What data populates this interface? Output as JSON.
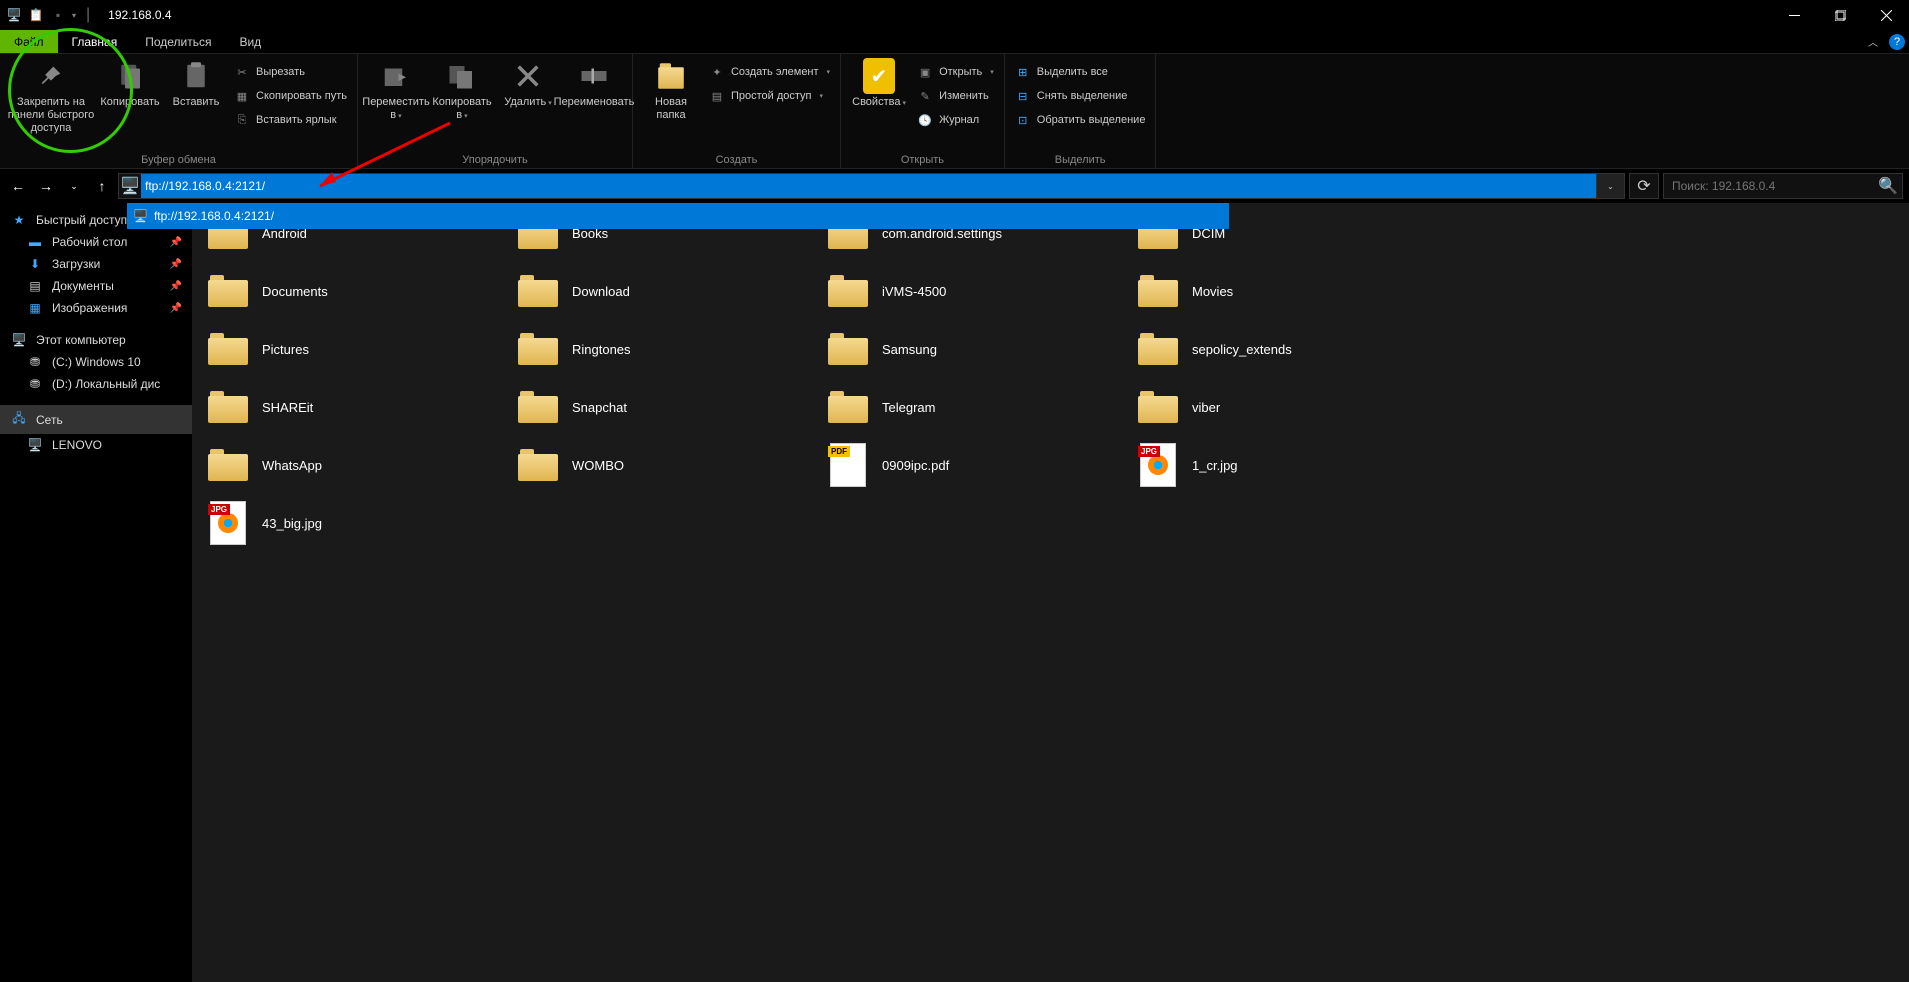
{
  "title": "192.168.0.4",
  "menu": {
    "file": "Файл",
    "tabs": [
      "Главная",
      "Поделиться",
      "Вид"
    ]
  },
  "ribbon": {
    "pin": "Закрепить на панели быстрого доступа",
    "copy": "Копировать",
    "paste": "Вставить",
    "cut": "Вырезать",
    "copypath": "Скопировать путь",
    "pasteshort": "Вставить ярлык",
    "g1": "Буфер обмена",
    "moveto": "Переместить в",
    "copyto": "Копировать в",
    "delete": "Удалить",
    "rename": "Переименовать",
    "g2": "Упорядочить",
    "newfolder": "Новая папка",
    "newitem": "Создать элемент",
    "easyaccess": "Простой доступ",
    "g3": "Создать",
    "properties": "Свойства",
    "open": "Открыть",
    "edit": "Изменить",
    "history": "Журнал",
    "g4": "Открыть",
    "selectall": "Выделить все",
    "selectnone": "Снять выделение",
    "invert": "Обратить выделение",
    "g5": "Выделить"
  },
  "address": "ftp://192.168.0.4:2121/",
  "address_dd": "ftp://192.168.0.4:2121/",
  "search_ph": "Поиск: 192.168.0.4",
  "sidebar": {
    "quick": "Быстрый доступ",
    "quickitems": [
      {
        "l": "Рабочий стол",
        "p": true
      },
      {
        "l": "Загрузки",
        "p": true
      },
      {
        "l": "Документы",
        "p": true
      },
      {
        "l": "Изображения",
        "p": true
      }
    ],
    "pc": "Этот компьютер",
    "drives": [
      "(C:) Windows 10",
      "(D:) Локальный дис"
    ],
    "network": "Сеть",
    "nethosts": [
      "LENOVO"
    ]
  },
  "items": [
    {
      "n": "Android",
      "t": "folder"
    },
    {
      "n": "Books",
      "t": "folder"
    },
    {
      "n": "com.android.settings",
      "t": "folder"
    },
    {
      "n": "DCIM",
      "t": "folder"
    },
    {
      "n": "Documents",
      "t": "folder"
    },
    {
      "n": "Download",
      "t": "folder"
    },
    {
      "n": "iVMS-4500",
      "t": "folder"
    },
    {
      "n": "Movies",
      "t": "folder"
    },
    {
      "n": "Pictures",
      "t": "folder"
    },
    {
      "n": "Ringtones",
      "t": "folder"
    },
    {
      "n": "Samsung",
      "t": "folder"
    },
    {
      "n": "sepolicy_extends",
      "t": "folder"
    },
    {
      "n": "SHAREit",
      "t": "folder"
    },
    {
      "n": "Snapchat",
      "t": "folder"
    },
    {
      "n": "Telegram",
      "t": "folder"
    },
    {
      "n": "viber",
      "t": "folder"
    },
    {
      "n": "WhatsApp",
      "t": "folder"
    },
    {
      "n": "WOMBO",
      "t": "folder"
    },
    {
      "n": "0909ipc.pdf",
      "t": "pdf"
    },
    {
      "n": "1_cr.jpg",
      "t": "jpg"
    },
    {
      "n": "43_big.jpg",
      "t": "jpg"
    }
  ]
}
